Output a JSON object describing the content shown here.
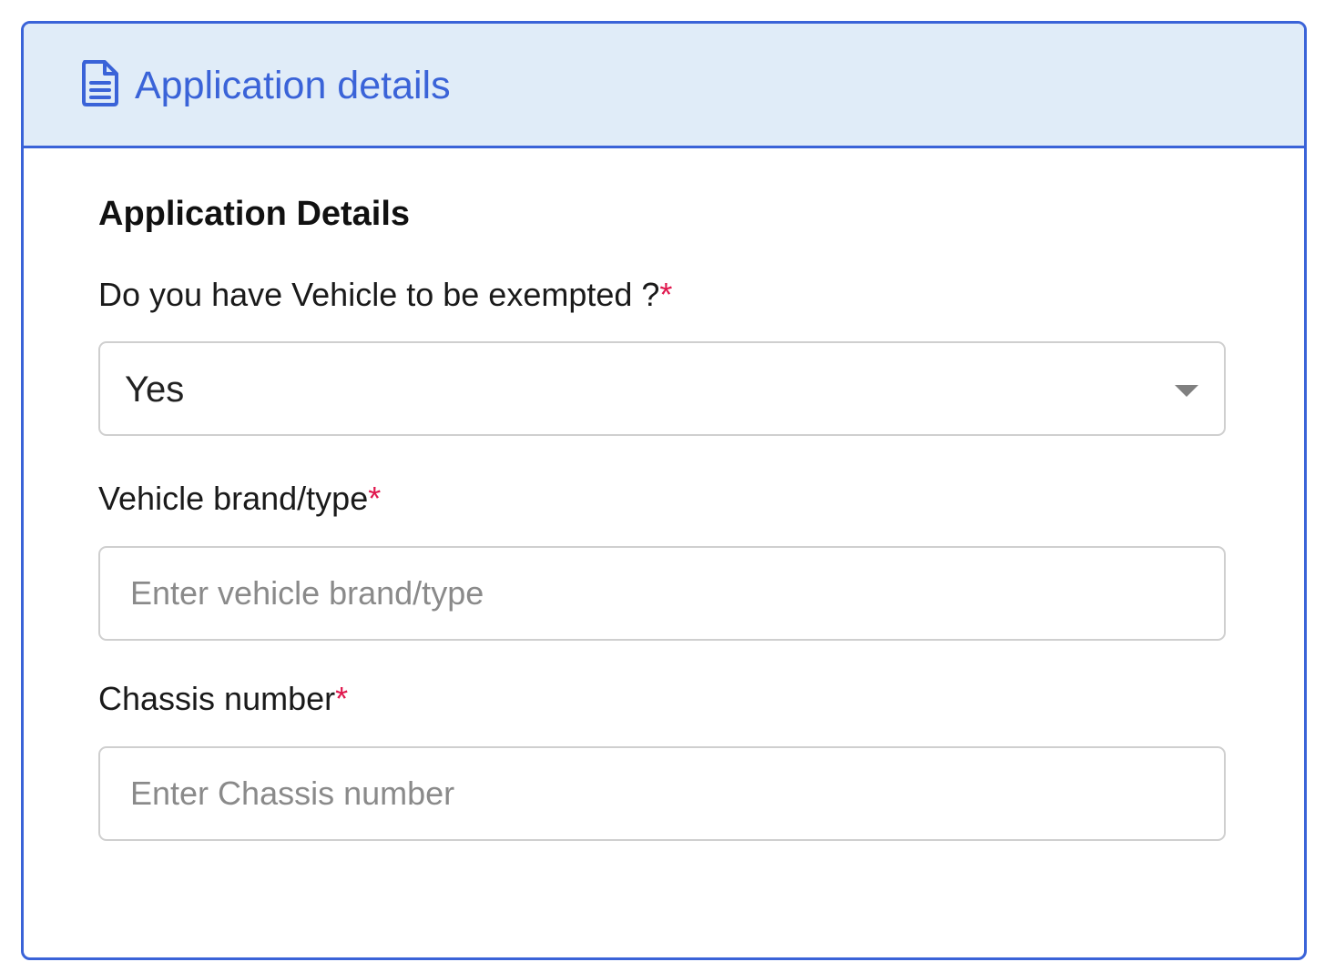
{
  "header": {
    "icon": "document-icon",
    "title": "Application details",
    "accent_color": "#3a63d8",
    "background_color": "#e0ecf8"
  },
  "section": {
    "title": "Application Details"
  },
  "fields": {
    "vehicle_exempt": {
      "label": "Do you have Vehicle to be exempted ?",
      "required_mark": "*",
      "value": "Yes"
    },
    "vehicle_brand": {
      "label": "Vehicle brand/type",
      "required_mark": "*",
      "value": "",
      "placeholder": "Enter vehicle brand/type"
    },
    "chassis_number": {
      "label": "Chassis number",
      "required_mark": "*",
      "value": "",
      "placeholder": "Enter Chassis number"
    }
  },
  "colors": {
    "required": "#e0174d"
  }
}
